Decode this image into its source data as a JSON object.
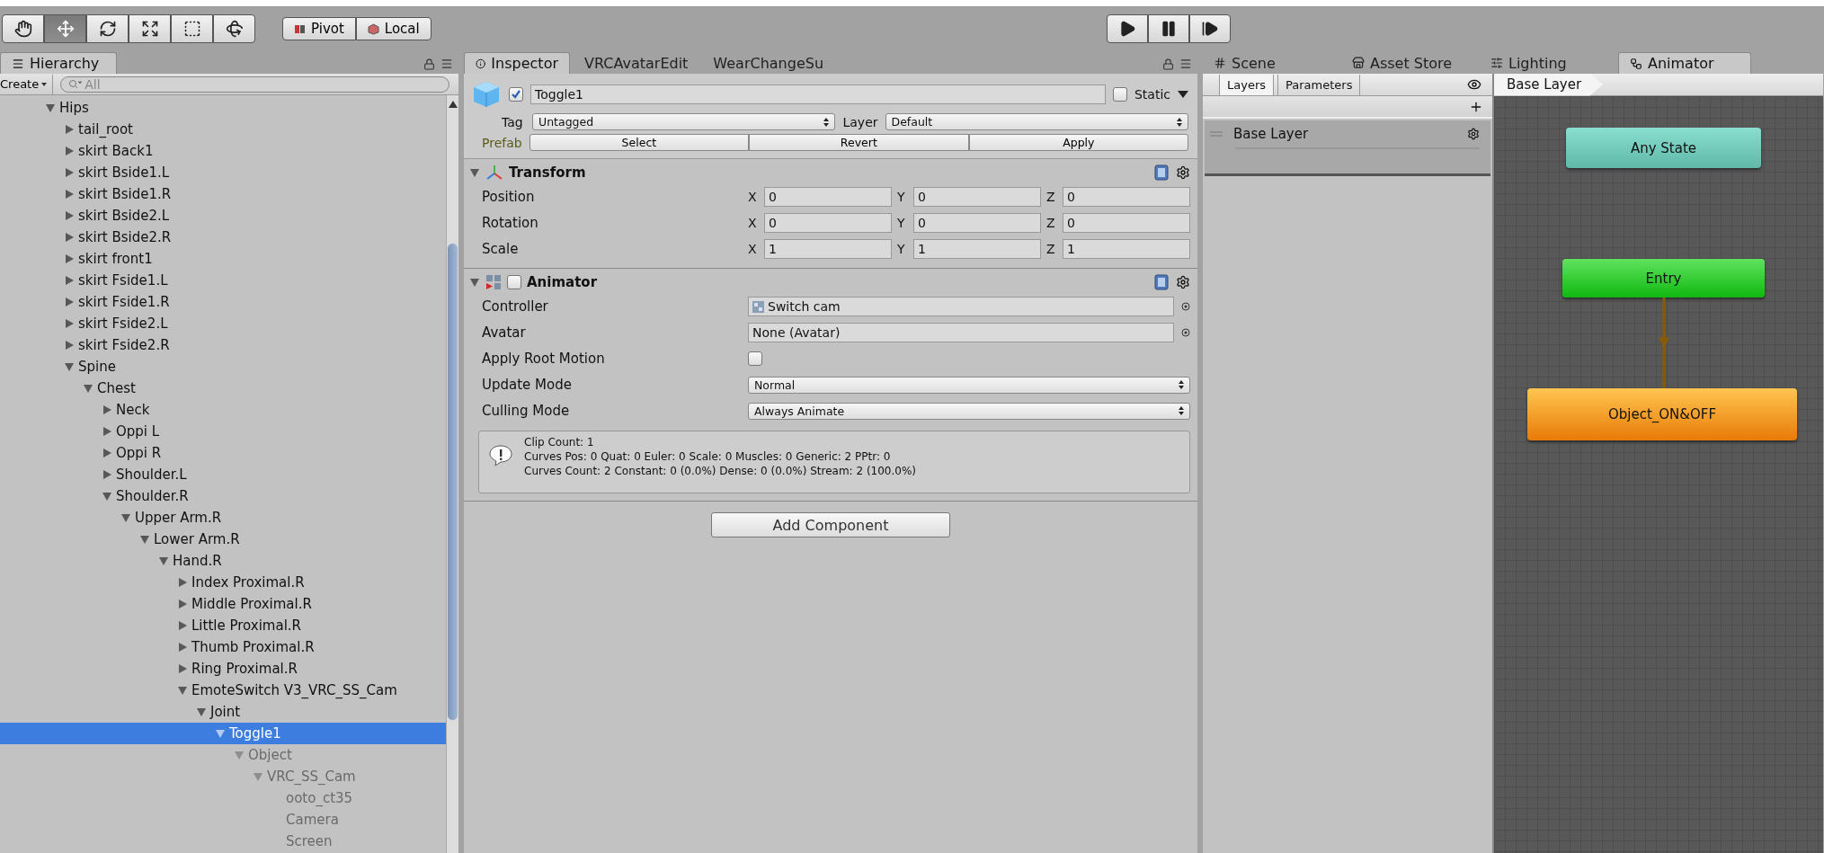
{
  "toolbar": {
    "tools": [
      {
        "kind": "hand",
        "selected": false
      },
      {
        "kind": "move",
        "selected": true
      },
      {
        "kind": "rotate",
        "selected": false
      },
      {
        "kind": "scale",
        "selected": false
      },
      {
        "kind": "rect",
        "selected": false
      },
      {
        "kind": "transform",
        "selected": false
      }
    ],
    "pivot": [
      {
        "kind": "pivot",
        "label": "Pivot"
      },
      {
        "kind": "local",
        "label": "Local"
      }
    ],
    "playback": [
      {
        "kind": "play",
        "selected": false
      },
      {
        "kind": "pause",
        "selected": false
      },
      {
        "kind": "step",
        "selected": false
      }
    ]
  },
  "hierarchy": {
    "tabs": [
      {
        "label": "Hierarchy",
        "selected": true
      }
    ],
    "create": "Create",
    "search": {
      "placeholder": "All"
    },
    "tree": [
      {
        "name": "Hips",
        "expanded": true,
        "selected": false,
        "active": true,
        "children": [
          {
            "name": "tail_root",
            "expanded": false,
            "selected": false,
            "active": true
          },
          {
            "name": "skirt Back1",
            "expanded": false,
            "selected": false,
            "active": true
          },
          {
            "name": "skirt Bside1.L",
            "expanded": false,
            "selected": false,
            "active": true
          },
          {
            "name": "skirt Bside1.R",
            "expanded": false,
            "selected": false,
            "active": true
          },
          {
            "name": "skirt Bside2.L",
            "expanded": false,
            "selected": false,
            "active": true
          },
          {
            "name": "skirt Bside2.R",
            "expanded": false,
            "selected": false,
            "active": true
          },
          {
            "name": "skirt front1",
            "expanded": false,
            "selected": false,
            "active": true
          },
          {
            "name": "skirt Fside1.L",
            "expanded": false,
            "selected": false,
            "active": true
          },
          {
            "name": "skirt Fside1.R",
            "expanded": false,
            "selected": false,
            "active": true
          },
          {
            "name": "skirt Fside2.L",
            "expanded": false,
            "selected": false,
            "active": true
          },
          {
            "name": "skirt Fside2.R",
            "expanded": false,
            "selected": false,
            "active": true
          },
          {
            "name": "Spine",
            "expanded": true,
            "selected": false,
            "active": true,
            "children": [
              {
                "name": "Chest",
                "expanded": true,
                "selected": false,
                "active": true,
                "children": [
                  {
                    "name": "Neck",
                    "expanded": false,
                    "selected": false,
                    "active": true
                  },
                  {
                    "name": "Oppi L",
                    "expanded": false,
                    "selected": false,
                    "active": true
                  },
                  {
                    "name": "Oppi R",
                    "expanded": false,
                    "selected": false,
                    "active": true
                  },
                  {
                    "name": "Shoulder.L",
                    "expanded": false,
                    "selected": false,
                    "active": true
                  },
                  {
                    "name": "Shoulder.R",
                    "expanded": true,
                    "selected": false,
                    "active": true,
                    "children": [
                      {
                        "name": "Upper Arm.R",
                        "expanded": true,
                        "selected": false,
                        "active": true,
                        "children": [
                          {
                            "name": "Lower Arm.R",
                            "expanded": true,
                            "selected": false,
                            "active": true,
                            "children": [
                              {
                                "name": "Hand.R",
                                "expanded": true,
                                "selected": false,
                                "active": true,
                                "children": [
                                  {
                                    "name": "Index Proximal.R",
                                    "expanded": false,
                                    "selected": false,
                                    "active": true
                                  },
                                  {
                                    "name": "Middle Proximal.R",
                                    "expanded": false,
                                    "selected": false,
                                    "active": true
                                  },
                                  {
                                    "name": "Little Proximal.R",
                                    "expanded": false,
                                    "selected": false,
                                    "active": true
                                  },
                                  {
                                    "name": "Thumb Proximal.R",
                                    "expanded": false,
                                    "selected": false,
                                    "active": true
                                  },
                                  {
                                    "name": "Ring Proximal.R",
                                    "expanded": false,
                                    "selected": false,
                                    "active": true
                                  },
                                  {
                                    "name": "EmoteSwitch V3_VRC_SS_Cam",
                                    "expanded": true,
                                    "selected": false,
                                    "active": true,
                                    "children": [
                                      {
                                        "name": "Joint",
                                        "expanded": true,
                                        "selected": false,
                                        "active": true,
                                        "children": [
                                          {
                                            "name": "Toggle1",
                                            "expanded": true,
                                            "selected": true,
                                            "active": true,
                                            "children": [
                                              {
                                                "name": "Object",
                                                "expanded": true,
                                                "selected": false,
                                                "active": false,
                                                "children": [
                                                  {
                                                    "name": "VRC_SS_Cam",
                                                    "expanded": true,
                                                    "selected": false,
                                                    "active": false,
                                                    "children": [
                                                      {
                                                        "name": "ooto_ct35",
                                                        "selected": false,
                                                        "active": false
                                                      },
                                                      {
                                                        "name": "Camera",
                                                        "selected": false,
                                                        "active": false
                                                      },
                                                      {
                                                        "name": "Screen",
                                                        "selected": false,
                                                        "active": false
                                                      }
                                                    ]
                                                  }
                                                ]
                                              }
                                            ]
                                          }
                                        ]
                                      }
                                    ]
                                  }
                                ]
                              }
                            ]
                          }
                        ]
                      }
                    ]
                  }
                ]
              }
            ]
          }
        ]
      }
    ]
  },
  "inspector": {
    "tabs": [
      {
        "label": "Inspector",
        "selected": true,
        "kind": "info"
      },
      {
        "label": "VRCAvatarEdit",
        "selected": false
      },
      {
        "label": "WearChangeSu",
        "selected": false
      }
    ],
    "object": {
      "active": true,
      "name": "Toggle1",
      "static": false,
      "static_label": "Static",
      "tag_label": "Tag",
      "tag": "Untagged",
      "layer_label": "Layer",
      "layer": "Default",
      "prefab_label": "Prefab",
      "prefab_buttons": [
        "Select",
        "Revert",
        "Apply"
      ]
    },
    "transform": {
      "title": "Transform",
      "expanded": true,
      "rows": [
        {
          "label": "Position",
          "values": [
            {
              "axis": "X",
              "value": "0"
            },
            {
              "axis": "Y",
              "value": "0"
            },
            {
              "axis": "Z",
              "value": "0"
            }
          ]
        },
        {
          "label": "Rotation",
          "values": [
            {
              "axis": "X",
              "value": "0"
            },
            {
              "axis": "Y",
              "value": "0"
            },
            {
              "axis": "Z",
              "value": "0"
            }
          ]
        },
        {
          "label": "Scale",
          "values": [
            {
              "axis": "X",
              "value": "1"
            },
            {
              "axis": "Y",
              "value": "1"
            },
            {
              "axis": "Z",
              "value": "1"
            }
          ]
        }
      ]
    },
    "animator": {
      "title": "Animator",
      "expanded": true,
      "enabled": false,
      "properties": [
        {
          "label": "Controller",
          "kind": "asset",
          "value": "Switch cam"
        },
        {
          "label": "Avatar",
          "kind": "object",
          "value": "None (Avatar)"
        },
        {
          "label": "Apply Root Motion",
          "kind": "checkbox",
          "checked": false
        },
        {
          "label": "Update Mode",
          "kind": "dropdown",
          "value": "Normal"
        },
        {
          "label": "Culling Mode",
          "kind": "dropdown",
          "value": "Always Animate"
        }
      ],
      "info": [
        "Clip Count: 1",
        "Curves Pos: 0 Quat: 0 Euler: 0 Scale: 0 Muscles: 0 Generic: 2 PPtr: 0",
        "Curves Count: 2 Constant: 0 (0.0%) Dense: 0 (0.0%) Stream: 2 (100.0%)"
      ]
    },
    "add_component": "Add Component"
  },
  "animator_window": {
    "tabs": [
      {
        "label": "Scene",
        "kind": "scene",
        "selected": false
      },
      {
        "label": "Asset Store",
        "kind": "store",
        "selected": false
      },
      {
        "label": "Lighting",
        "kind": "lighting",
        "selected": false
      },
      {
        "label": "Animator",
        "kind": "animator",
        "selected": true
      }
    ],
    "subtabs": [
      {
        "label": "Layers",
        "selected": true
      },
      {
        "label": "Parameters",
        "selected": false
      }
    ],
    "layers": [
      {
        "name": "Base Layer",
        "selected": true
      }
    ],
    "breadcrumb": "Base Layer",
    "nodes": [
      {
        "label": "Any State",
        "kind": "any",
        "transition_to_next": false
      },
      {
        "label": "Entry",
        "kind": "entry",
        "transition_to_next": true
      },
      {
        "label": "Object_ON&OFF",
        "kind": "state"
      }
    ]
  }
}
